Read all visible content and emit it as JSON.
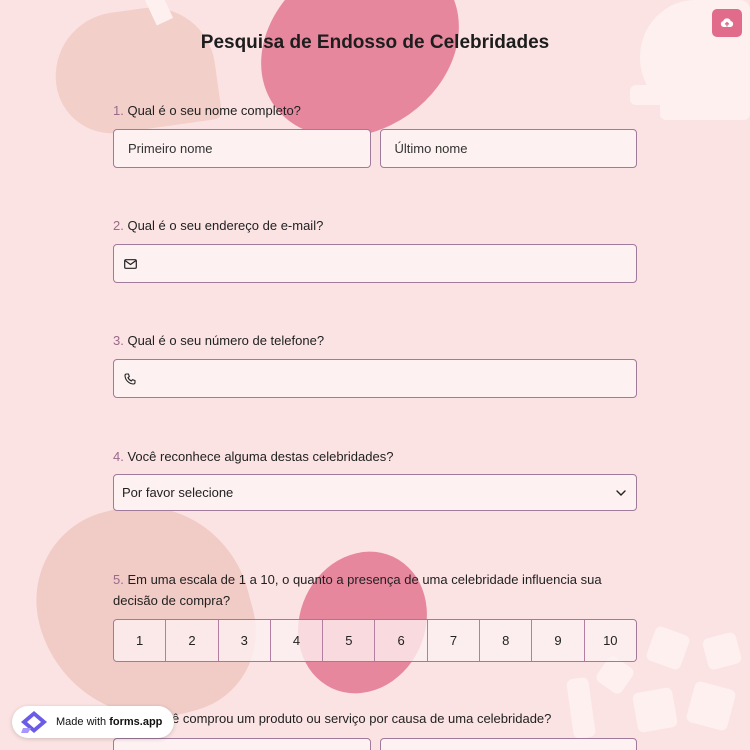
{
  "form": {
    "title": "Pesquisa de Endosso de Celebridades"
  },
  "questions": {
    "q1": {
      "number": "1.",
      "label": "Qual é o seu nome completo?",
      "first_placeholder": "Primeiro nome",
      "last_placeholder": "Último nome"
    },
    "q2": {
      "number": "2.",
      "label": "Qual é o seu endereço de e-mail?"
    },
    "q3": {
      "number": "3.",
      "label": "Qual é o seu número de telefone?"
    },
    "q4": {
      "number": "4.",
      "label": "Você reconhece alguma destas celebridades?",
      "select_value": "Por favor selecione"
    },
    "q5": {
      "number": "5.",
      "label_line1": "Em uma escala de 1 a 10, o quanto a presença de uma celebridade influencia sua",
      "label_line2": "decisão de compra?",
      "scale": [
        "1",
        "2",
        "3",
        "4",
        "5",
        "6",
        "7",
        "8",
        "9",
        "10"
      ]
    },
    "q6": {
      "label_partial": "ê comprou um produto ou serviço por causa de uma celebridade?"
    }
  },
  "badge": {
    "prefix": "Made with ",
    "brand": "forms.app"
  },
  "icons": {
    "upload": "cloud-upload-icon",
    "email": "envelope-icon",
    "phone": "phone-icon",
    "dropdown": "chevron-down-icon",
    "brand": "forms-app-logo-icon"
  },
  "colors": {
    "background": "#fbe3e3",
    "accent": "#e06b8a",
    "border": "#a07a9a",
    "blob": "#e47f98"
  }
}
